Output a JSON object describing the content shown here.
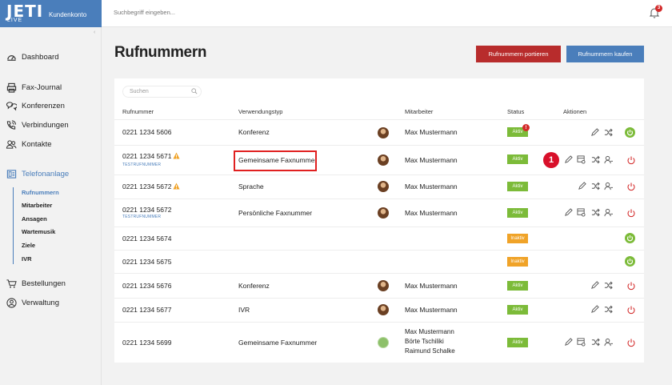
{
  "brand": {
    "logo": "JETI",
    "logo_sub": "LIVE",
    "account": "Kundenkonto",
    "color": "#4a7ebb"
  },
  "topbar": {
    "search_placeholder": "Suchbegriff eingeben...",
    "notification_count": "3"
  },
  "sidebar": {
    "items": [
      {
        "label": "Dashboard",
        "icon": "dashboard-icon"
      },
      {
        "label": "Fax-Journal",
        "icon": "fax-icon"
      },
      {
        "label": "Konferenzen",
        "icon": "conference-icon"
      },
      {
        "label": "Verbindungen",
        "icon": "phone-icon"
      },
      {
        "label": "Kontakte",
        "icon": "contacts-icon"
      },
      {
        "label": "Telefonanlage",
        "icon": "phone-system-icon",
        "active": true
      },
      {
        "label": "Bestellungen",
        "icon": "cart-icon"
      },
      {
        "label": "Verwaltung",
        "icon": "user-admin-icon"
      }
    ],
    "subitems": [
      "Rufnummern",
      "Mitarbeiter",
      "Ansagen",
      "Wartemusik",
      "Ziele",
      "IVR"
    ]
  },
  "main": {
    "title": "Rufnummern",
    "btn_port": "Rufnummern portieren",
    "btn_buy": "Rufnummern kaufen",
    "search_placeholder": "Suchen",
    "columns": [
      "Rufnummer",
      "Verwendungstyp",
      "Mitarbeiter",
      "Status",
      "Aktionen"
    ]
  },
  "rows": [
    {
      "number": "0221 1234 5606",
      "type": "Konferenz",
      "employee": "Max Mustermann",
      "status": "Aktiv",
      "status_badge": "!"
    },
    {
      "number": "0221 1234 5671",
      "test": "TESTRUFNUMMER",
      "type": "Gemeinsame Faxnummer",
      "employee": "Max Mustermann",
      "status": "Aktiv"
    },
    {
      "number": "0221 1234 5672",
      "type": "Sprache",
      "employee": "Max Mustermann",
      "status": "Aktiv"
    },
    {
      "number": "0221 1234 5672",
      "test": "TESTRUFNUMMER",
      "type": "Persönliche Faxnummer",
      "employee": "Max Mustermann",
      "status": "Aktiv"
    },
    {
      "number": "0221 1234 5674",
      "type": "",
      "employee": "",
      "status": "Inaktiv"
    },
    {
      "number": "0221 1234 5675",
      "type": "",
      "employee": "",
      "status": "Inaktiv"
    },
    {
      "number": "0221 1234 5676",
      "type": "Konferenz",
      "employee": "Max Mustermann",
      "status": "Aktiv"
    },
    {
      "number": "0221 1234 5677",
      "type": "IVR",
      "employee": "Max Mustermann",
      "status": "Aktiv"
    },
    {
      "number": "0221 1234 5699",
      "type": "Gemeinsame Faxnummer",
      "employees": [
        "Max Mustermann",
        "Börte Tschiliki",
        "Raimund Schalke"
      ],
      "status": "Aktiv"
    }
  ],
  "annotation": "1",
  "colors": {
    "aktiv": "#7cbb39",
    "inaktiv": "#f0a328",
    "red": "#b82c2c",
    "highlight": "#e02020"
  }
}
